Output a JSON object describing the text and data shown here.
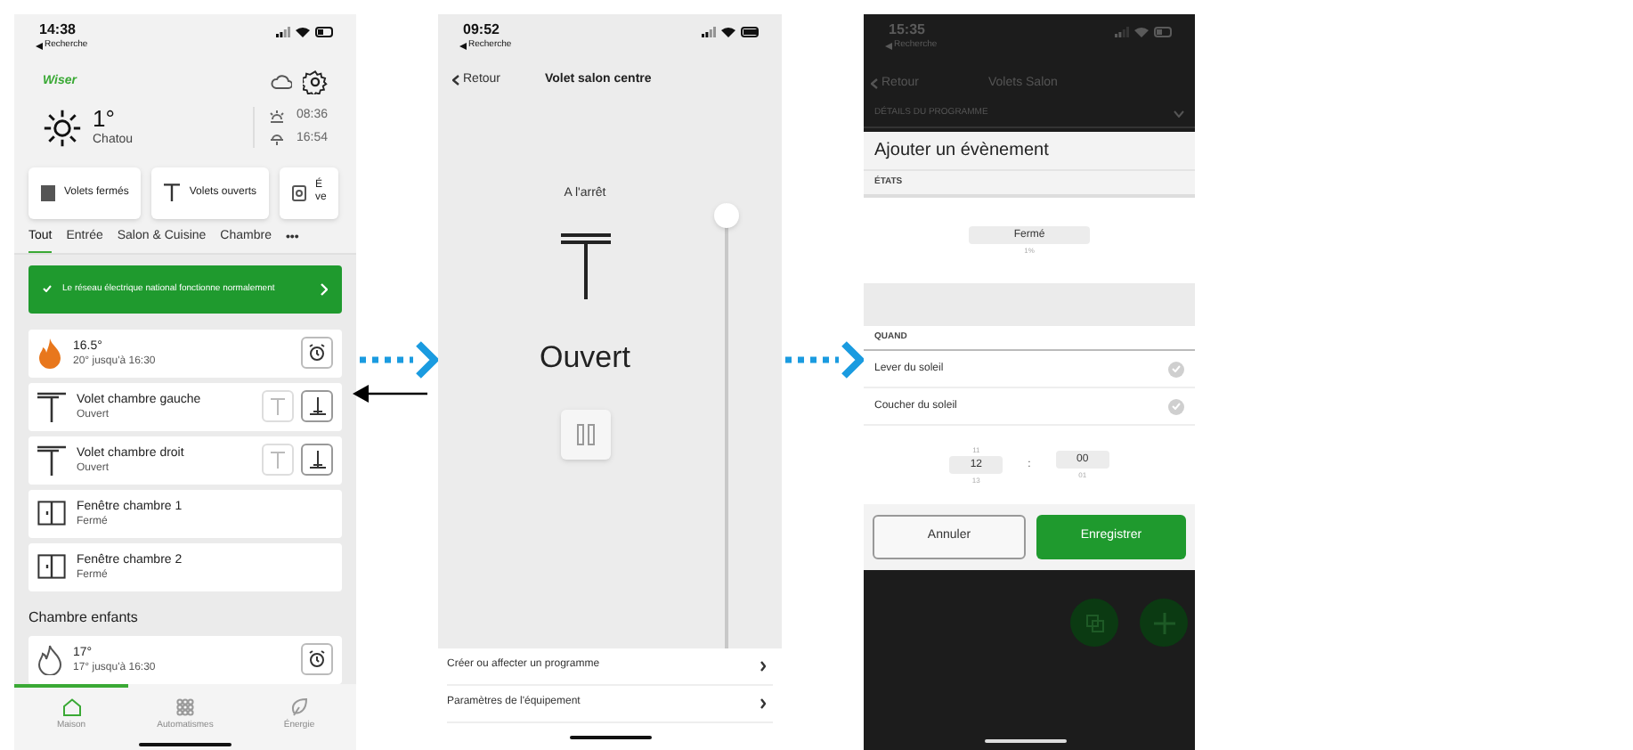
{
  "home_screen": {
    "status_bar": {
      "time": "14:38",
      "back_app": "Recherche"
    },
    "logo": "Wiser",
    "weather": {
      "temperature": "1°",
      "city": "Chatou",
      "sunrise": "08:36",
      "sunset": "16:54"
    },
    "shortcuts": [
      {
        "kind": "closed",
        "lines": [
          "Volets fermés"
        ]
      },
      {
        "kind": "open",
        "lines": [
          "Volets ouverts"
        ]
      },
      {
        "kind": "scene",
        "lines": [
          "É",
          "ve"
        ]
      }
    ],
    "tabs": [
      {
        "label": "Tout",
        "selected": true
      },
      {
        "label": "Entrée",
        "selected": false
      },
      {
        "label": "Salon & Cuisine",
        "selected": false
      },
      {
        "label": "Chambre",
        "selected": false
      }
    ],
    "more": "•••",
    "banner": {
      "text": "Le réseau électrique national fonctionne normalement"
    },
    "groups": [
      {
        "devices": [
          {
            "kind": "heating",
            "name": "16.5°",
            "status": "20° jusqu'à 16:30",
            "heating": true
          },
          {
            "kind": "shutter",
            "name": "Volet chambre gauche",
            "status": "Ouvert"
          },
          {
            "kind": "shutter",
            "name": "Volet chambre droit",
            "status": "Ouvert"
          },
          {
            "kind": "window",
            "name": "Fenêtre chambre 1",
            "status": "Fermé"
          },
          {
            "kind": "window",
            "name": "Fenêtre chambre 2",
            "status": "Fermé"
          }
        ]
      },
      {
        "title": "Chambre enfants",
        "devices": [
          {
            "kind": "heating",
            "name": "17°",
            "status": "17° jusqu'à 16:30",
            "heating": false
          }
        ]
      }
    ],
    "bottom_nav": [
      {
        "kind": "home",
        "label": "Maison",
        "selected": true
      },
      {
        "kind": "grid",
        "label": "Automatismes",
        "selected": false
      },
      {
        "kind": "leaf",
        "label": "Énergie",
        "selected": false
      }
    ]
  },
  "device_screen": {
    "status_bar": {
      "time": "09:52",
      "back_app": "Recherche"
    },
    "back": "Retour",
    "title": "Volet salon centre",
    "motion": "A l'arrêt",
    "state": "Ouvert",
    "position": {
      "level": 1
    },
    "menu": [
      "Créer ou affecter un programme",
      "Paramètres de l'équipement"
    ]
  },
  "program_screen": {
    "status_bar": {
      "time": "15:35",
      "back_app": "Recherche"
    },
    "back": "Retour",
    "title": "Volets Salon",
    "section": "DÉTAILS DU PROGRAMME",
    "sheet": {
      "title": "Ajouter un évènement",
      "states_label": "ÉTATS",
      "states": [
        {
          "label": "Fermé",
          "selected": true
        },
        {
          "label": "1%",
          "selected": false
        }
      ],
      "when_label": "QUAND",
      "options": [
        {
          "label": "Lever du soleil",
          "checked": false
        },
        {
          "label": "Coucher du soleil",
          "checked": false
        }
      ],
      "hours": [
        {
          "label": "11",
          "selected": false
        },
        {
          "label": "12",
          "selected": true
        },
        {
          "label": "13",
          "selected": false
        }
      ],
      "separator": ":",
      "minutes": [
        {
          "label": "00",
          "selected": true
        },
        {
          "label": "01",
          "selected": false
        }
      ],
      "buttons": [
        {
          "kind": "secondary",
          "label": "Annuler"
        },
        {
          "kind": "primary",
          "label": "Enregistrer"
        }
      ]
    }
  }
}
